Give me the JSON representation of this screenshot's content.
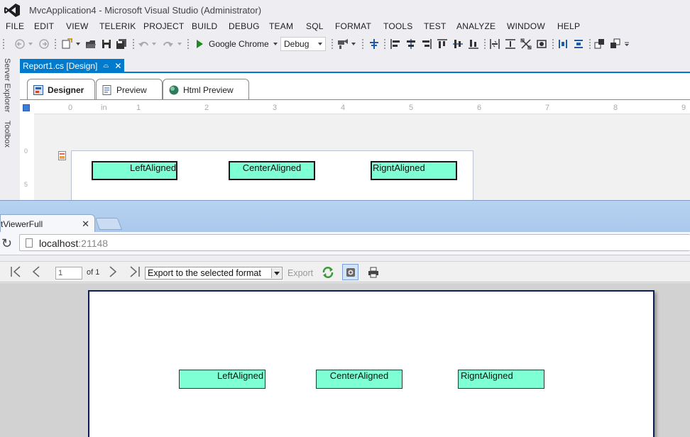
{
  "vs": {
    "title": "MvcApplication4 - Microsoft Visual Studio (Administrator)",
    "menu": [
      "FILE",
      "EDIT",
      "VIEW",
      "TELERIK",
      "PROJECT",
      "BUILD",
      "DEBUG",
      "TEAM",
      "SQL",
      "FORMAT",
      "TOOLS",
      "TEST",
      "ANALYZE",
      "WINDOW",
      "HELP"
    ],
    "toolbar": {
      "run_target": "Google Chrome",
      "configuration": "Debug"
    },
    "side_panels": [
      "Server Explorer",
      "Toolbox"
    ],
    "document_tab": {
      "label": "Report1.cs [Design]",
      "pin_glyph": "⌓",
      "close_glyph": "✕"
    },
    "view_tabs": [
      "Designer",
      "Preview",
      "Html Preview"
    ],
    "ruler": {
      "unit": "in",
      "numbers": [
        "0",
        "1",
        "2",
        "3",
        "4",
        "5",
        "6",
        "7",
        "8",
        "9"
      ],
      "vertical_numbers": [
        "0",
        "5"
      ]
    },
    "textboxes": [
      "LeftAligned",
      "CenterAligned",
      "RigntAligned"
    ]
  },
  "browser": {
    "tab_title": "tViewerFull",
    "tab_close": "✕",
    "url_host": "localhost",
    "url_port": ":21148",
    "reload_glyph": "↻"
  },
  "viewer": {
    "nav_first": "⏮",
    "page_number": "1",
    "page_of": "of 1",
    "export_format": "Export to the selected format",
    "export_label": "Export",
    "textboxes": [
      "LeftAligned",
      "CenterAligned",
      "RigntAligned"
    ],
    "textbox_color": "#7fffd4"
  },
  "colors": {
    "vs_accent": "#007acc",
    "vs_logo": "#68217a",
    "page_border": "#0c1d5e"
  }
}
